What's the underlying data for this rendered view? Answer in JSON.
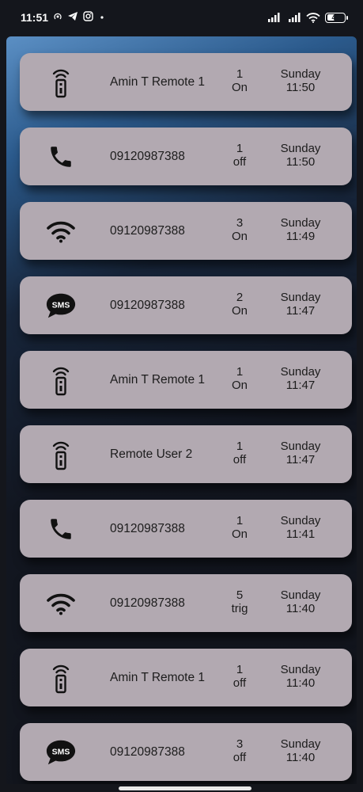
{
  "status_bar": {
    "time": "11:51",
    "battery": "46",
    "battery_level": 0.46,
    "left_icons": [
      "hotspot-icon",
      "telegram-icon",
      "instagram-icon",
      "dot-icon"
    ],
    "right_icons": [
      "signal-icon",
      "signal-icon",
      "wifi-icon",
      "battery-icon"
    ]
  },
  "colors": {
    "card": "#b2a9b1",
    "text": "#1c1c1c",
    "background_top": "#5b8fc4",
    "background_bottom": "#12151c"
  },
  "events": [
    {
      "icon": "remote-icon",
      "name": "Amin T Remote 1",
      "count": "1",
      "state": "On",
      "day": "Sunday",
      "time": "11:50"
    },
    {
      "icon": "phone-icon",
      "name": "09120987388",
      "count": "1",
      "state": "off",
      "day": "Sunday",
      "time": "11:50"
    },
    {
      "icon": "wifi-icon",
      "name": "09120987388",
      "count": "3",
      "state": "On",
      "day": "Sunday",
      "time": "11:49"
    },
    {
      "icon": "sms-icon",
      "name": "09120987388",
      "count": "2",
      "state": "On",
      "day": "Sunday",
      "time": "11:47"
    },
    {
      "icon": "remote-icon",
      "name": "Amin T Remote 1",
      "count": "1",
      "state": "On",
      "day": "Sunday",
      "time": "11:47"
    },
    {
      "icon": "remote-icon",
      "name": "Remote User 2",
      "count": "1",
      "state": "off",
      "day": "Sunday",
      "time": "11:47"
    },
    {
      "icon": "phone-icon",
      "name": "09120987388",
      "count": "1",
      "state": "On",
      "day": "Sunday",
      "time": "11:41"
    },
    {
      "icon": "wifi-icon",
      "name": "09120987388",
      "count": "5",
      "state": "trig",
      "day": "Sunday",
      "time": "11:40"
    },
    {
      "icon": "remote-icon",
      "name": "Amin T Remote 1",
      "count": "1",
      "state": "off",
      "day": "Sunday",
      "time": "11:40"
    },
    {
      "icon": "sms-icon",
      "name": "09120987388",
      "count": "3",
      "state": "off",
      "day": "Sunday",
      "time": "11:40"
    }
  ]
}
